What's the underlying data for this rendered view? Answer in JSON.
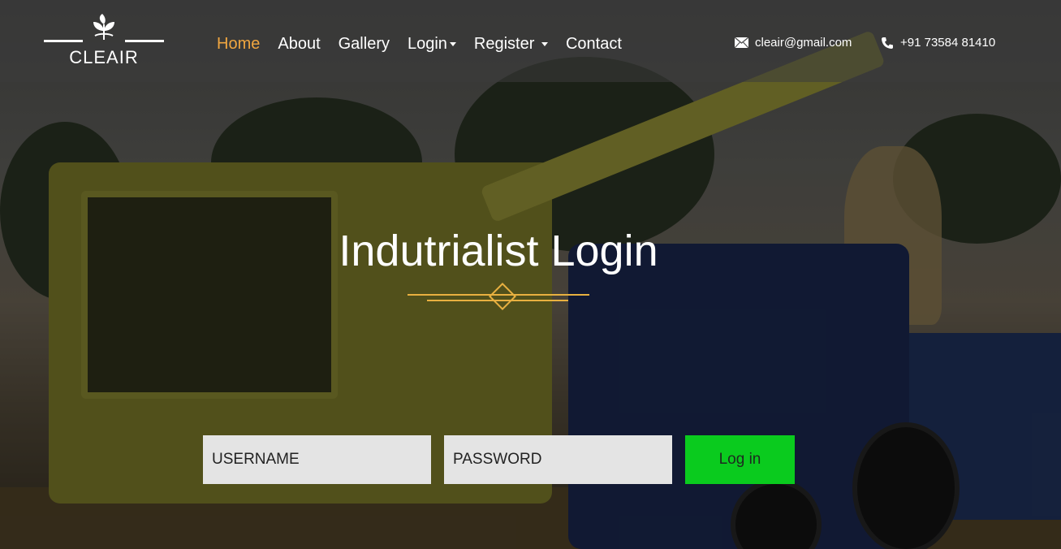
{
  "brand": {
    "name": "CLEAIR",
    "icon": "leaf-sprout-icon"
  },
  "nav": {
    "items": [
      {
        "label": "Home",
        "active": true,
        "dropdown": false
      },
      {
        "label": "About",
        "active": false,
        "dropdown": false
      },
      {
        "label": "Gallery",
        "active": false,
        "dropdown": false
      },
      {
        "label": "Login",
        "active": false,
        "dropdown": true
      },
      {
        "label": "Register",
        "active": false,
        "dropdown": true
      },
      {
        "label": "Contact",
        "active": false,
        "dropdown": false
      }
    ]
  },
  "contact": {
    "email": "cleair@gmail.com",
    "email_icon": "envelope-icon",
    "phone": "+91 73584 81410",
    "phone_icon": "phone-icon"
  },
  "hero": {
    "title": "Indutrialist Login"
  },
  "form": {
    "username_placeholder": "USERNAME",
    "password_placeholder": "PASSWORD",
    "submit_label": "Log in"
  },
  "colors": {
    "accent": "#f0a640",
    "submit_button": "#0acb1e",
    "input_bg": "#e4e4e4"
  }
}
